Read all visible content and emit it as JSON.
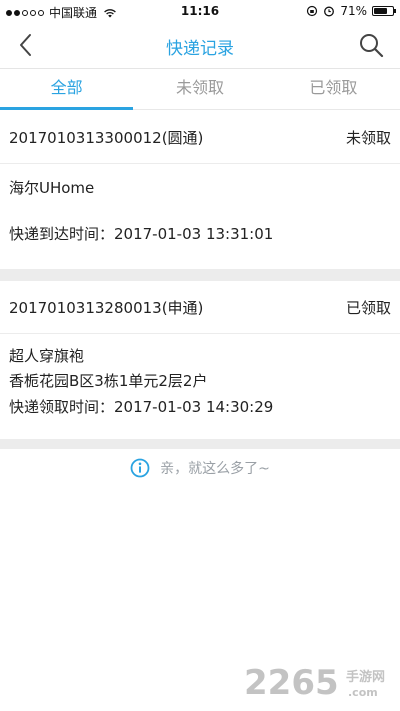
{
  "status_bar": {
    "carrier": "中国联通",
    "time": "11:16",
    "battery": "71%",
    "battery_level": 0.71
  },
  "nav": {
    "title": "快递记录",
    "back_icon": "chevron-left-icon",
    "search_icon": "search-icon"
  },
  "tabs": [
    {
      "label": "全部",
      "active": true
    },
    {
      "label": "未领取",
      "active": false
    },
    {
      "label": "已领取",
      "active": false
    }
  ],
  "records": [
    {
      "code": "2017010313300012(圆通)",
      "status": "未领取",
      "name": "海尔UHome",
      "address": "",
      "time_label": "快递到达时间：2017-01-03 13:31:01"
    },
    {
      "code": "2017010313280013(申通)",
      "status": "已领取",
      "name": "超人穿旗袍",
      "address": "香栀花园B区3栋1单元2层2户",
      "time_label": "快递领取时间：2017-01-03 14:30:29"
    }
  ],
  "footer": {
    "text": "亲，就这么多了~"
  },
  "watermark": {
    "number": "2265",
    "suffix": "手游网",
    "domain": ".com"
  },
  "colors": {
    "accent": "#2aa3e1",
    "muted": "#9a9a9a",
    "separator": "#ececec"
  }
}
